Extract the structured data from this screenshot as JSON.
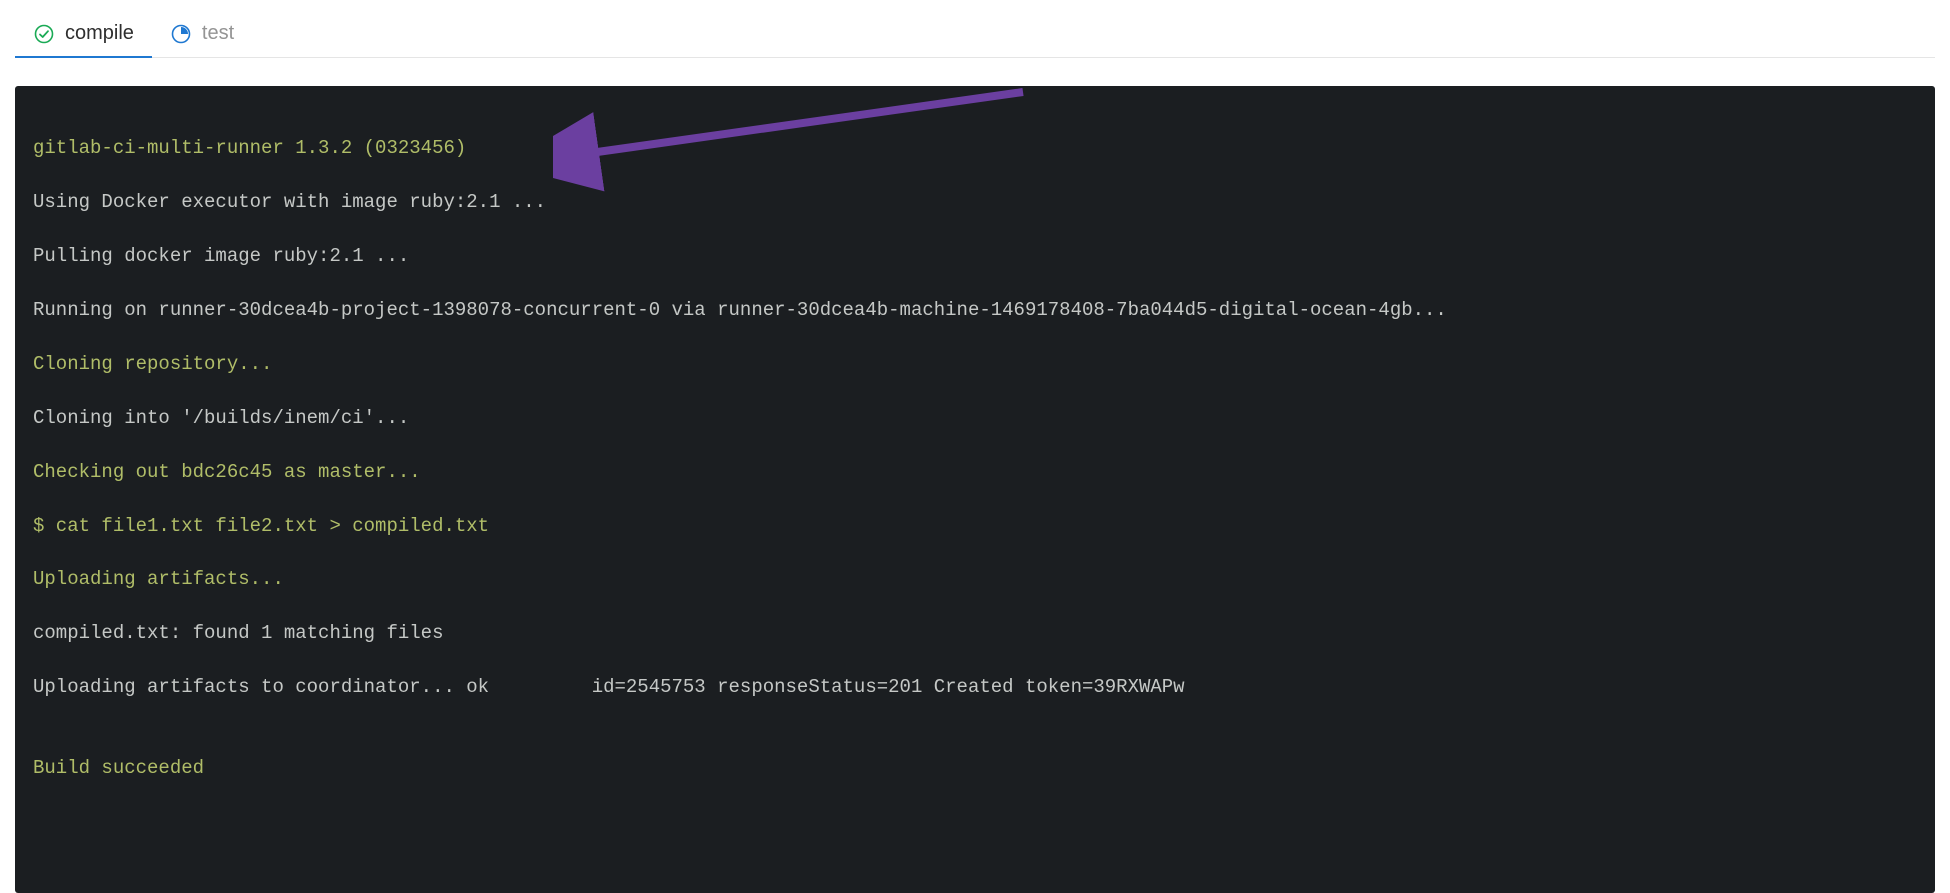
{
  "tabs": {
    "compile": {
      "label": "compile"
    },
    "test": {
      "label": "test"
    }
  },
  "terminal": {
    "line1": "gitlab-ci-multi-runner 1.3.2 (0323456)",
    "line2": "Using Docker executor with image ruby:2.1 ...",
    "line3": "Pulling docker image ruby:2.1 ...",
    "line4": "Running on runner-30dcea4b-project-1398078-concurrent-0 via runner-30dcea4b-machine-1469178408-7ba044d5-digital-ocean-4gb...",
    "line5": "Cloning repository...",
    "line6": "Cloning into '/builds/inem/ci'...",
    "line7": "Checking out bdc26c45 as master...",
    "line8": "$ cat file1.txt file2.txt > compiled.txt",
    "line9": "Uploading artifacts...",
    "line10": "compiled.txt: found 1 matching files ",
    "line11": "Uploading artifacts to coordinator... ok         id=2545753 responseStatus=201 Created token=39RXWAPw",
    "line12": "",
    "line13": "Build succeeded"
  }
}
